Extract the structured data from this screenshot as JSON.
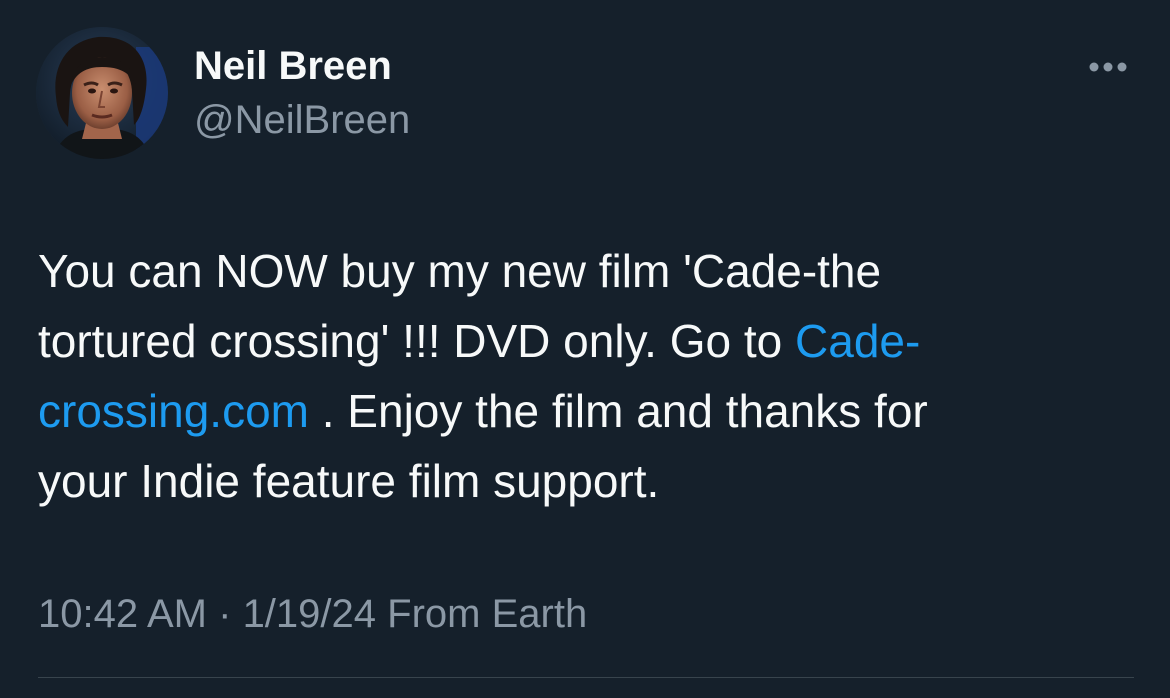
{
  "tweet": {
    "author": {
      "display_name": "Neil Breen",
      "handle": "@NeilBreen"
    },
    "text": {
      "line1": "You can NOW buy my new film 'Cade-the",
      "line2_part1": "tortured crossing' !!! DVD only. Go to ",
      "link_part1": "Cade-",
      "link_part2": "crossing.com",
      "line3_part2": " . Enjoy the film and thanks for",
      "line4": "your Indie feature film support."
    },
    "meta": {
      "time": "10:42 AM",
      "separator": " · ",
      "date": "1/19/24",
      "source": " From Earth"
    },
    "more_icon": "more-horizontal-icon"
  },
  "colors": {
    "background": "#15202b",
    "text": "#f7f9f9",
    "secondary_text": "#8b98a5",
    "link": "#1d9bf0",
    "divider": "#38444d"
  }
}
